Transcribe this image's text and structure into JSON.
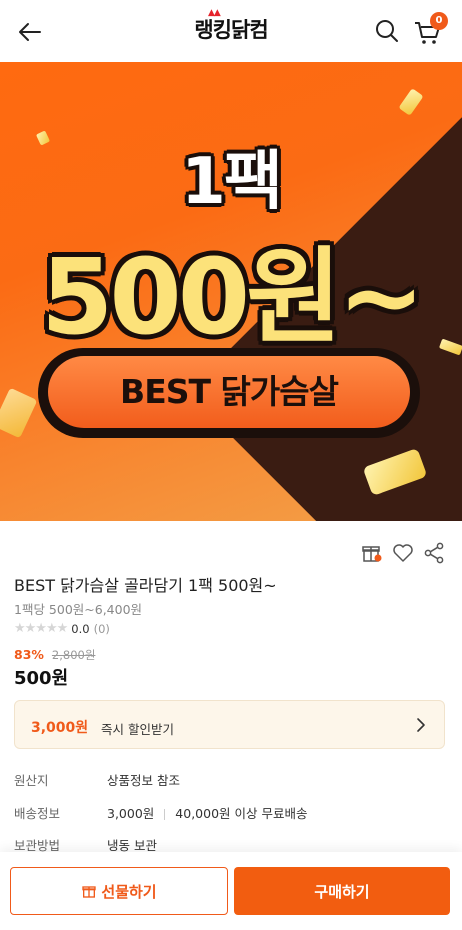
{
  "header": {
    "logo_text": "랭킹닭컴",
    "cart_count": "0",
    "icons": [
      "back-arrow-icon",
      "search-icon",
      "cart-icon"
    ]
  },
  "banner": {
    "line1": "1팩",
    "line2": "500원~",
    "pill": "BEST 닭가슴살",
    "colors": {
      "bg": "#fb6b14",
      "accent_text": "#fce27a",
      "pill": "#f25d1c"
    }
  },
  "product": {
    "title": "BEST 닭가슴살 골라담기 1팩 500원~",
    "sub_price": "1팩당 500원~6,400원",
    "stars": "★★★★★",
    "rating": "0.0",
    "review_count": "(0)",
    "discount_pct": "83%",
    "original_price": "2,800원",
    "price": "500원"
  },
  "coupon": {
    "amount": "3,000원",
    "text": "즉시 할인받기"
  },
  "info": {
    "origin_label": "원산지",
    "origin_value": "상품정보 참조",
    "shipping_label": "배송정보",
    "shipping_fee": "3,000원",
    "shipping_free": "40,000원 이상 무료배송",
    "storage_label": "보관방법",
    "storage_value": "냉동 보관"
  },
  "bottom": {
    "gift_label": "선물하기",
    "buy_label": "구매하기",
    "accent": "#f25d10"
  }
}
